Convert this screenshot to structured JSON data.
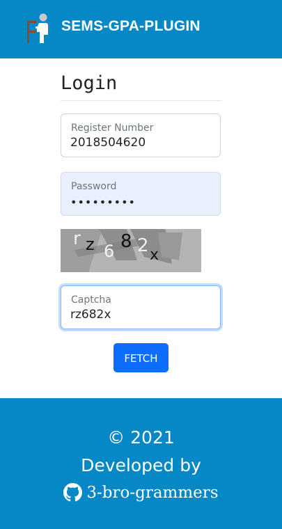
{
  "header": {
    "title": "SEMS-GPA-PLUGIN",
    "logo_icon": "person-at-desk-icon"
  },
  "login": {
    "heading": "Login",
    "register": {
      "label": "Register Number",
      "value": "2018504620"
    },
    "password": {
      "label": "Password",
      "value": "•••••••••"
    },
    "captcha_image": {
      "text": "rz682x"
    },
    "captcha": {
      "label": "Captcha",
      "value": "rz682x"
    },
    "fetch_label": "FETCH"
  },
  "footer": {
    "copyright": "© 2021",
    "developed_by": "Developed by",
    "author": "3-bro-grammers",
    "author_icon": "github-icon"
  },
  "colors": {
    "header_bg": "#0788c6",
    "footer_bg": "#0788c6",
    "button_bg": "#0d6efd",
    "autofill_bg": "#e8f0fe"
  }
}
